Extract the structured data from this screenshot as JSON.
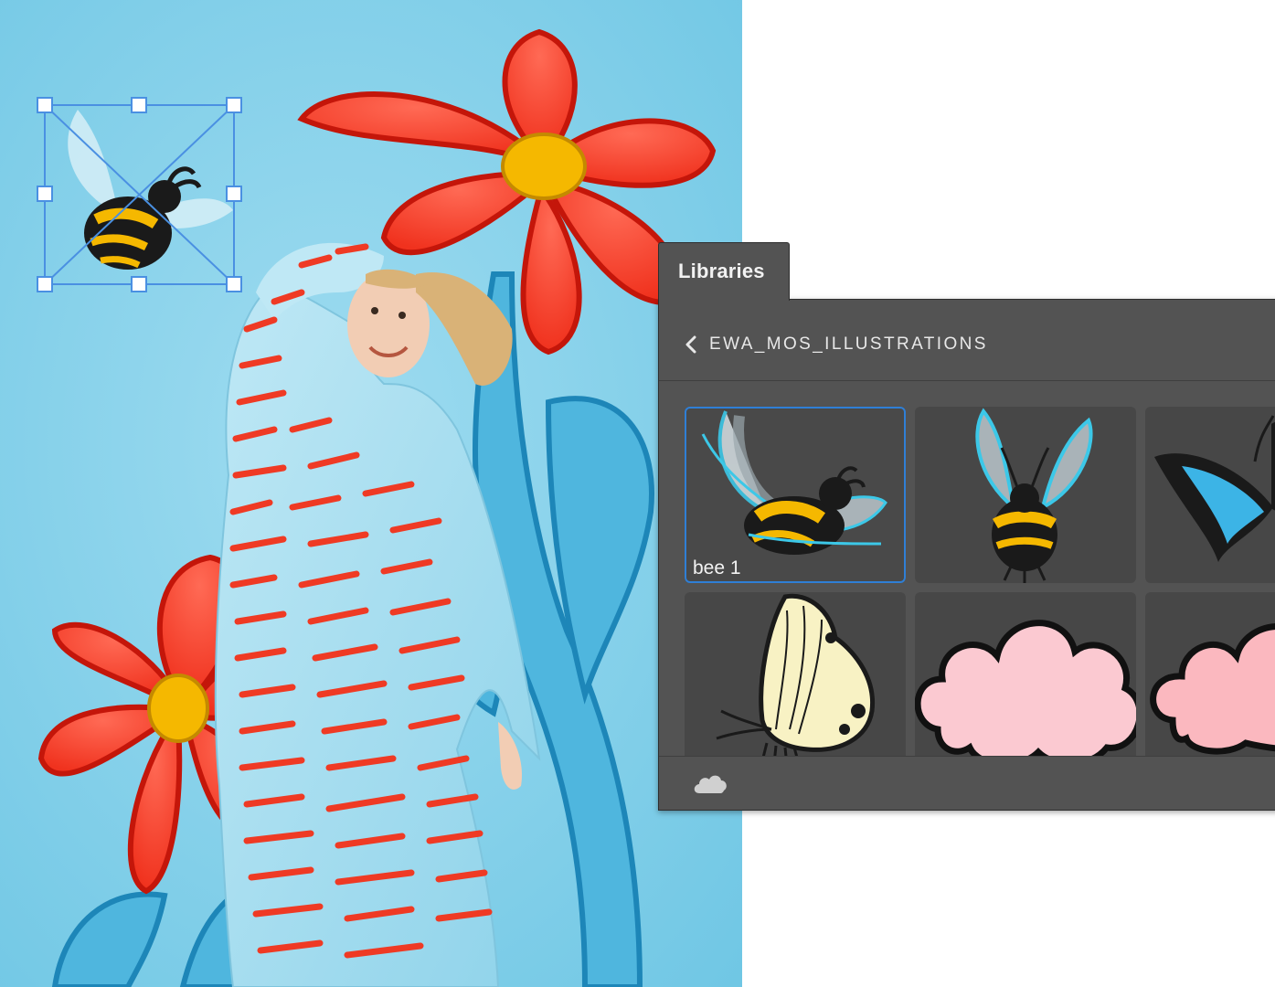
{
  "panel": {
    "tab_title": "Libraries",
    "library_name": "EWA_MOS_ILLUSTRATIONS"
  },
  "assets": [
    {
      "label": "bee 1",
      "icon": "bee-flying-icon",
      "selected": true
    },
    {
      "label": "",
      "icon": "bee-front-icon",
      "selected": false
    },
    {
      "label": "",
      "icon": "blue-butterfly-icon",
      "selected": false
    },
    {
      "label": "",
      "icon": "yellow-butterfly-icon",
      "selected": false
    },
    {
      "label": "",
      "icon": "pink-cloud-icon",
      "selected": false
    },
    {
      "label": "",
      "icon": "pink-cloud-icon",
      "selected": false
    }
  ],
  "footer": {
    "icon": "cloud-icon"
  },
  "colors": {
    "accent": "#2f7fd6",
    "panel_bg": "#535353",
    "tile_bg": "#474747",
    "canvas_bg": "#8fd3ea",
    "flower_red": "#f0321e",
    "flower_center": "#f5b800"
  }
}
